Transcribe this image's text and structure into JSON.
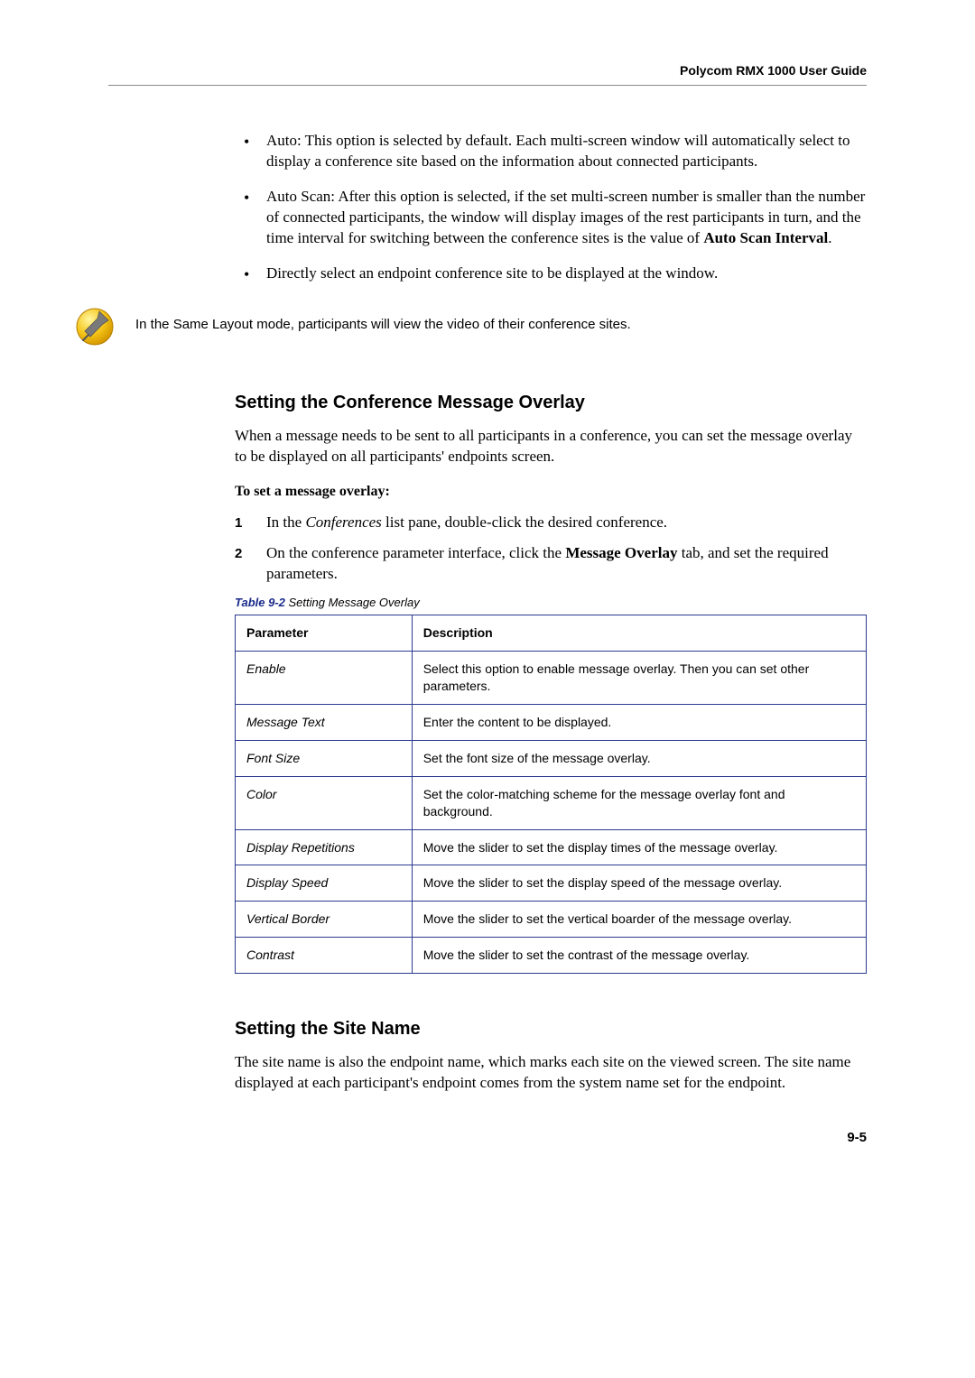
{
  "header": {
    "guide_title": "Polycom RMX 1000 User Guide"
  },
  "bullets": {
    "b1_pre": "Auto: This option is selected by default. Each multi-screen window will automatically select to display a conference site based on the information about connected participants.",
    "b2_pre": "Auto Scan: After this option is selected, if the set multi-screen number is smaller than the number of connected participants, the window will display images of the rest participants in turn, and the time interval for switching between the conference sites is the value of ",
    "b2_bold": "Auto Scan Interval",
    "b2_post": ".",
    "b3": "Directly select an endpoint conference site to be displayed at the window."
  },
  "note": {
    "text": "In the Same Layout mode, participants will view the video of their conference sites."
  },
  "section1": {
    "heading": "Setting the Conference Message Overlay",
    "intro": "When a message needs to be sent to all participants in a conference, you can set the message overlay to be displayed on all participants' endpoints screen.",
    "procedure_title": "To set a message overlay:",
    "step1_pre": "In the ",
    "step1_italic": "Conferences",
    "step1_post": " list pane, double-click the desired conference.",
    "step2_pre": "On the conference parameter interface, click the ",
    "step2_bold": "Message Overlay",
    "step2_post": " tab, and set the required parameters.",
    "num1": "1",
    "num2": "2"
  },
  "table": {
    "caption_label": "Table 9-2",
    "caption_rest": " Setting Message Overlay",
    "th_param": "Parameter",
    "th_desc": "Description",
    "rows": [
      {
        "param": "Enable",
        "desc": "Select this option to enable message overlay. Then you can set other parameters."
      },
      {
        "param": "Message Text",
        "desc": "Enter the content to be displayed."
      },
      {
        "param": "Font Size",
        "desc": "Set the font size of the message overlay."
      },
      {
        "param": "Color",
        "desc": "Set the color-matching scheme for the message overlay font and background."
      },
      {
        "param": "Display Repetitions",
        "desc": "Move the slider to set the display times of the message overlay."
      },
      {
        "param": "Display Speed",
        "desc": "Move the slider to set the display speed of the message overlay."
      },
      {
        "param": "Vertical Border",
        "desc": "Move the slider to set the vertical boarder of the message overlay."
      },
      {
        "param": "Contrast",
        "desc": "Move the slider to set the contrast of the message overlay."
      }
    ]
  },
  "section2": {
    "heading": "Setting the Site Name",
    "body": "The site name is also the endpoint name, which marks each site on the viewed screen. The site name displayed at each participant's endpoint comes from the system name set for the endpoint."
  },
  "footer": {
    "page_number": "9-5"
  }
}
